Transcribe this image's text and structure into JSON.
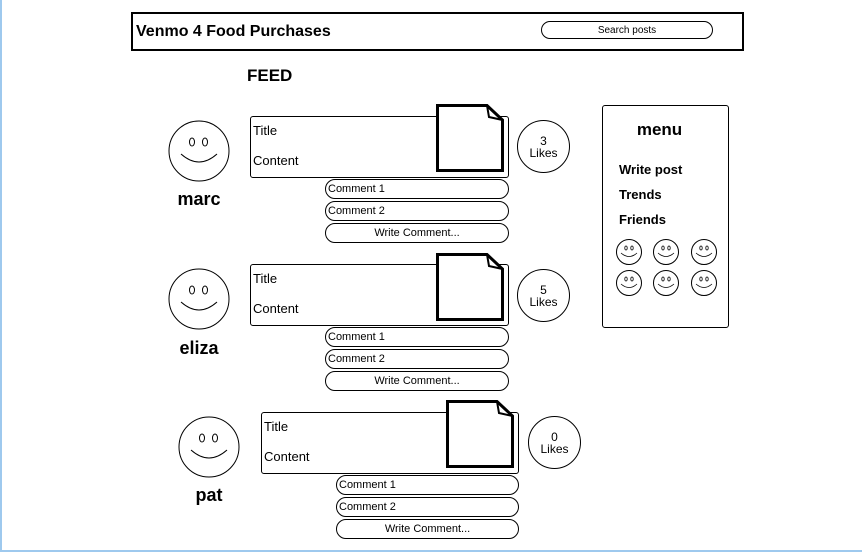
{
  "header": {
    "app_title": "Venmo 4 Food Purchases",
    "search_label": "Search posts"
  },
  "feed": {
    "title": "FEED",
    "posts": [
      {
        "user": "marc",
        "title": "Title",
        "content": "Content",
        "likes_count": "3",
        "likes_label": "Likes",
        "comments": [
          "Comment 1",
          "Comment 2"
        ],
        "write_comment": "Write Comment..."
      },
      {
        "user": "eliza",
        "title": "Title",
        "content": "Content",
        "likes_count": "5",
        "likes_label": "Likes",
        "comments": [
          "Comment 1",
          "Comment 2"
        ],
        "write_comment": "Write Comment..."
      },
      {
        "user": "pat",
        "title": "Title",
        "content": "Content",
        "likes_count": "0",
        "likes_label": "Likes",
        "comments": [
          "Comment 1",
          "Comment 2"
        ],
        "write_comment": "Write Comment..."
      }
    ]
  },
  "menu": {
    "title": "menu",
    "items": [
      "Write post",
      "Trends",
      "Friends"
    ],
    "friend_icon": "smiley-face-icon",
    "friend_count": 6
  },
  "icons": {
    "avatar": "smiley-face-icon",
    "attachment": "document-icon"
  },
  "colors": {
    "frame_accent": "#9ec9ee"
  }
}
